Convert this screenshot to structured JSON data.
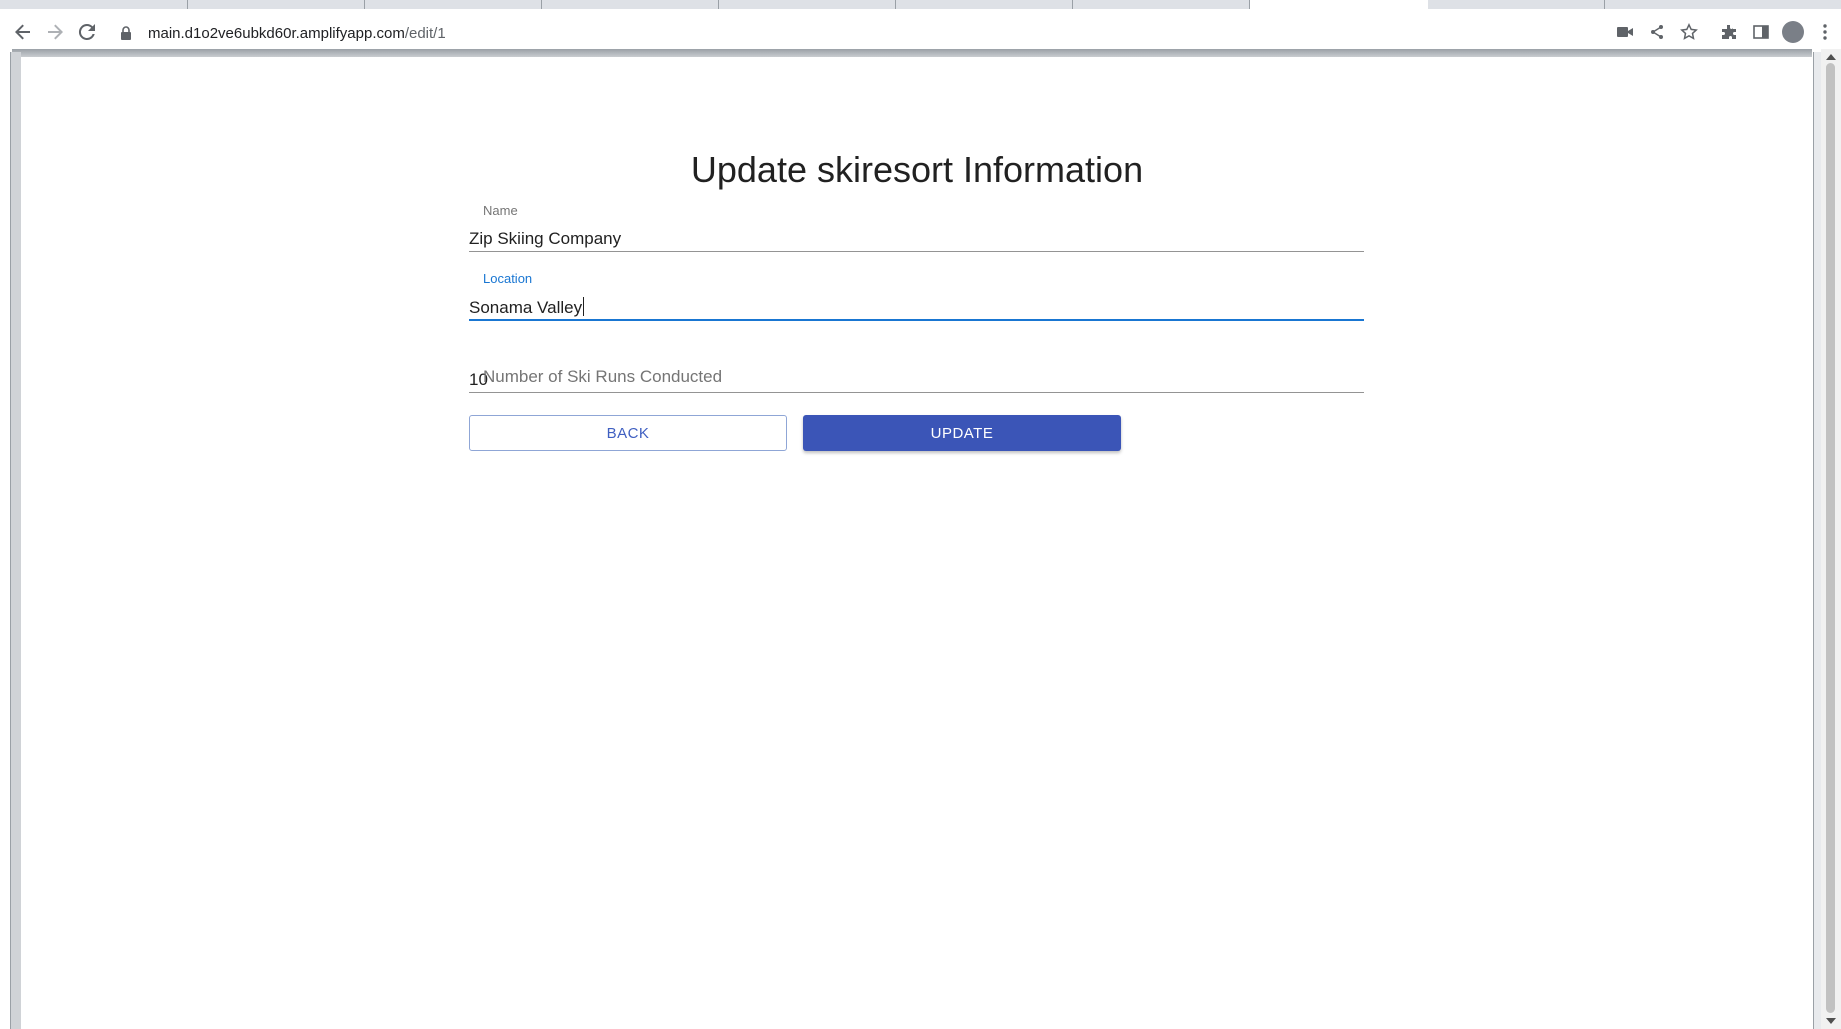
{
  "browser": {
    "url_host": "main.d1o2ve6ubkd60r.amplifyapp.com",
    "url_path": "/edit/1"
  },
  "form": {
    "title": "Update skiresort Information",
    "name": {
      "label": "Name",
      "value": "Zip Skiing Company"
    },
    "location": {
      "label": "Location",
      "value": "Sonama Valley"
    },
    "runs": {
      "value": "10",
      "placeholder": "Number of Ski Runs Conducted"
    },
    "back_label": "BACK",
    "update_label": "UPDATE"
  },
  "colors": {
    "accent": "#1976d2",
    "primary_button": "#3b55b7"
  }
}
